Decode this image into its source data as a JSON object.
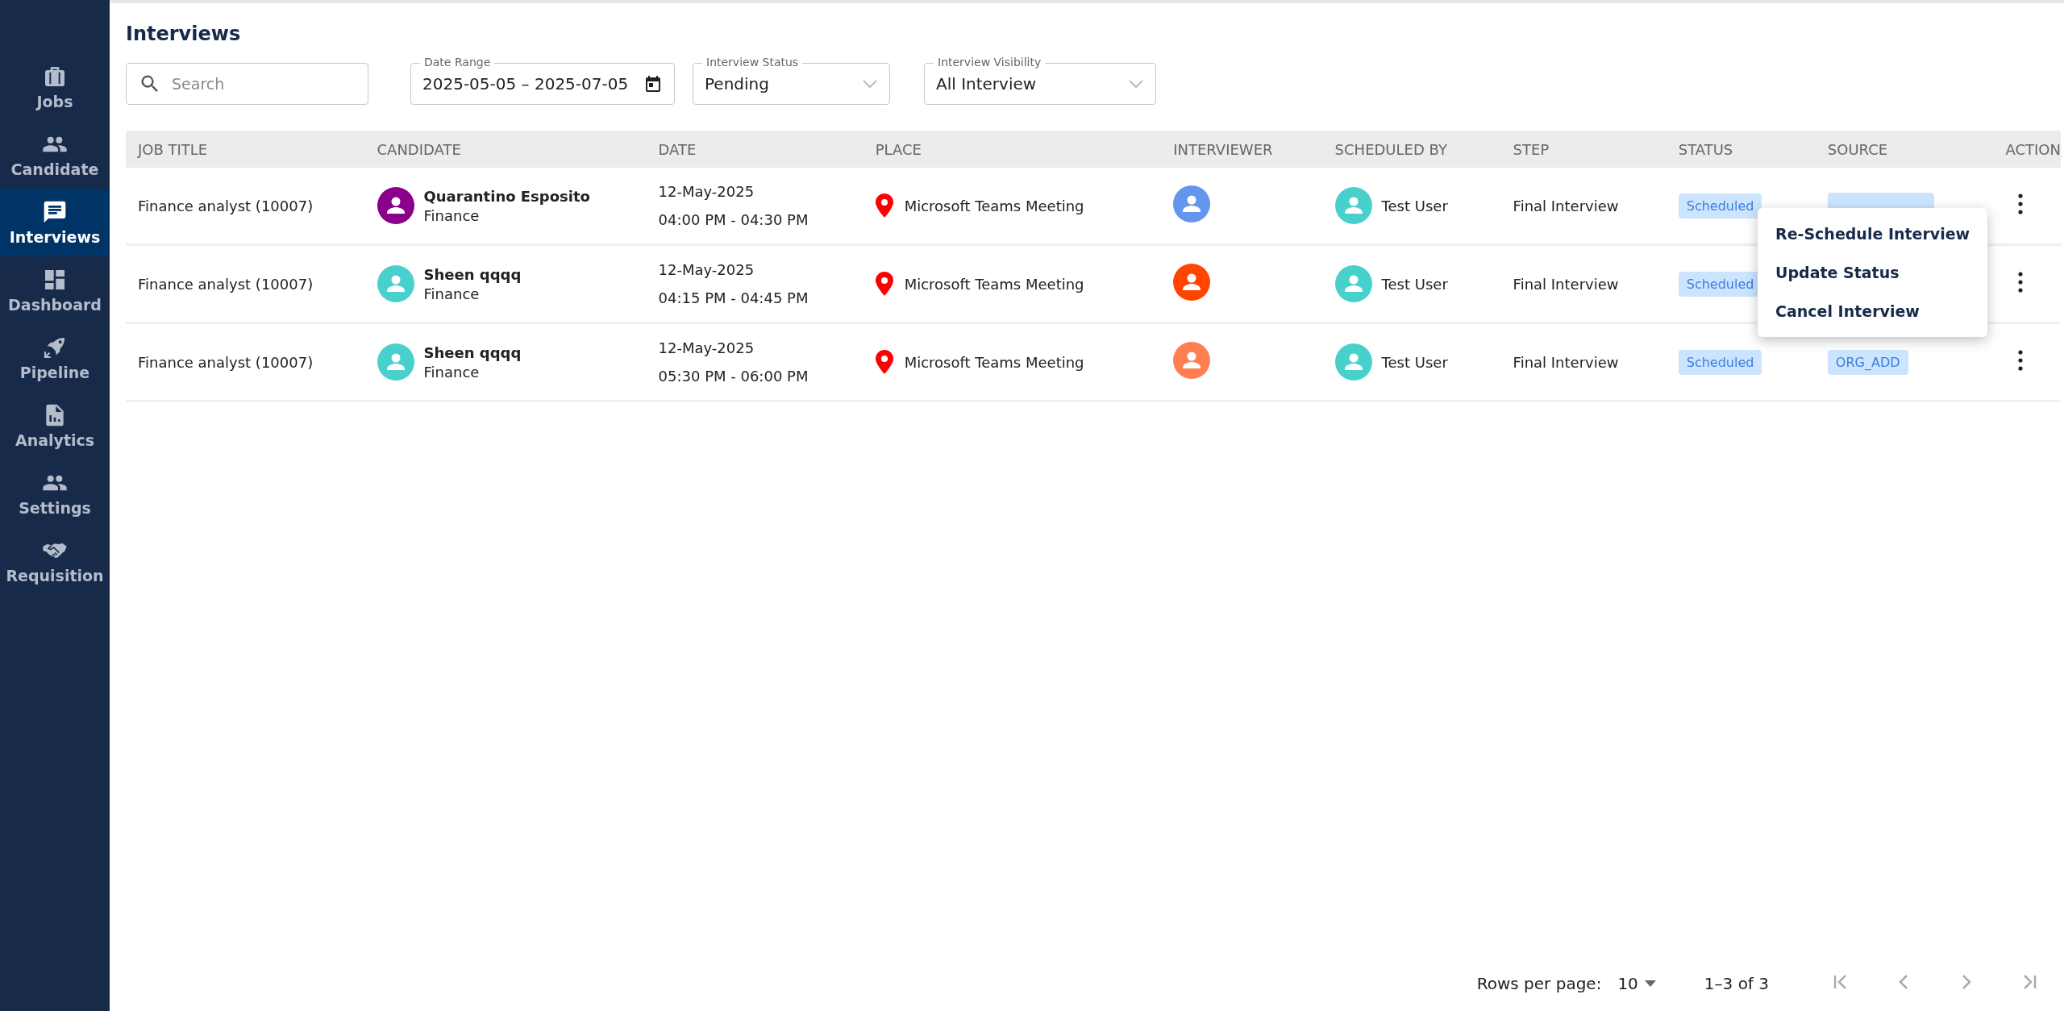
{
  "sidebar": {
    "items": [
      {
        "label": "Jobs",
        "selected": false
      },
      {
        "label": "Candidate",
        "selected": false
      },
      {
        "label": "Interviews",
        "selected": true
      },
      {
        "label": "Dashboard",
        "selected": false
      },
      {
        "label": "Pipeline",
        "selected": false
      },
      {
        "label": "Analytics",
        "selected": false
      },
      {
        "label": "Settings",
        "selected": false
      },
      {
        "label": "Requisition",
        "selected": false
      }
    ]
  },
  "page_title": "Interviews",
  "filters": {
    "search": {
      "placeholder": "Search"
    },
    "date_range": {
      "label": "Date Range",
      "value": "2025-05-05 – 2025-07-05"
    },
    "interview_status": {
      "label": "Interview Status",
      "value": "Pending"
    },
    "interview_visibility": {
      "label": "Interview Visibility",
      "value": "All Interview"
    }
  },
  "table": {
    "columns": [
      "JOB TITLE",
      "CANDIDATE",
      "DATE",
      "PLACE",
      "INTERVIEWER",
      "SCHEDULED BY",
      "STEP",
      "STATUS",
      "SOURCE",
      "ACTION"
    ],
    "rows": [
      {
        "job_title": "Finance analyst (10007)",
        "candidate": {
          "name": "Quarantino Esposito",
          "department": "Finance",
          "color": "#8b008b"
        },
        "date": "12-May-2025",
        "time": "04:00 PM - 04:30 PM",
        "place": "Microsoft Teams Meeting",
        "interviewer": {
          "color": "#6495ed"
        },
        "scheduled_by": {
          "name": "Test User",
          "color": "#48d1cc"
        },
        "step": "Final Interview",
        "status": "Scheduled",
        "source": {
          "covered": true
        }
      },
      {
        "job_title": "Finance analyst (10007)",
        "candidate": {
          "name": "Sheen qqqq",
          "department": "Finance",
          "color": "#48d1cc"
        },
        "date": "12-May-2025",
        "time": "04:15 PM - 04:45 PM",
        "place": "Microsoft Teams Meeting",
        "interviewer": {
          "color": "#ff4500"
        },
        "scheduled_by": {
          "name": "Test User",
          "color": "#48d1cc"
        },
        "step": "Final Interview",
        "status": "Scheduled"
      },
      {
        "job_title": "Finance analyst (10007)",
        "candidate": {
          "name": "Sheen qqqq",
          "department": "Finance",
          "color": "#48d1cc"
        },
        "date": "12-May-2025",
        "time": "05:30 PM - 06:00 PM",
        "place": "Microsoft Teams Meeting",
        "interviewer": {
          "color": "#ff7f50"
        },
        "scheduled_by": {
          "name": "Test User",
          "color": "#48d1cc"
        },
        "step": "Final Interview",
        "status": "Scheduled",
        "source": {
          "label": "ORG_ADD"
        }
      }
    ]
  },
  "action_menu": {
    "items": [
      "Re-Schedule Interview",
      "Update Status",
      "Cancel Interview"
    ]
  },
  "pagination": {
    "rows_per_page_label": "Rows per page:",
    "rows_per_page": "10",
    "range": "1–3 of 3"
  }
}
